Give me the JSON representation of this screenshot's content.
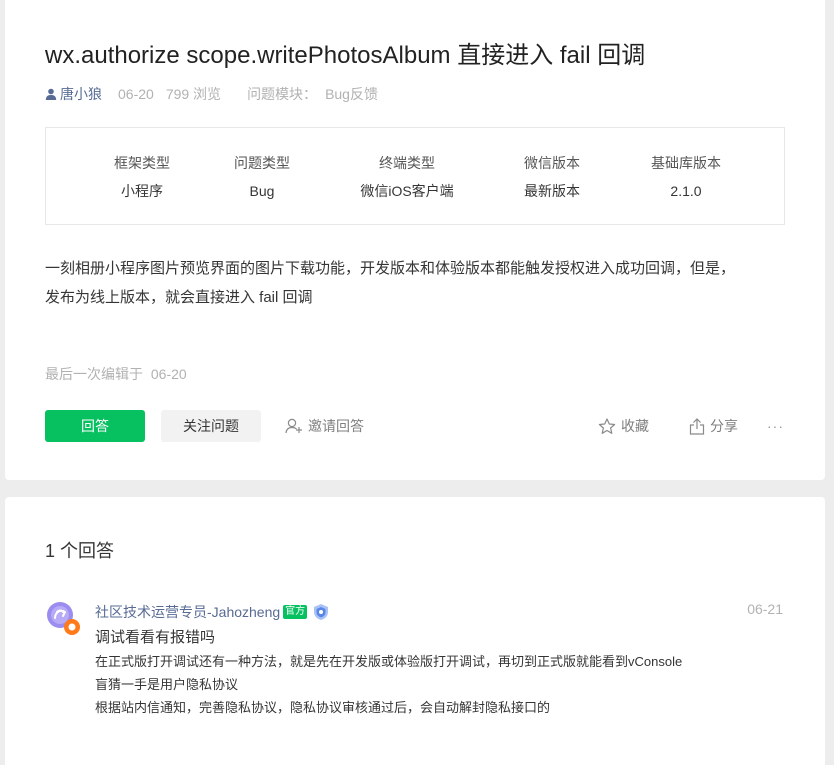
{
  "question": {
    "title": "wx.authorize scope.writePhotosAlbum 直接进入 fail 回调",
    "author": "唐小狼",
    "date": "06-20",
    "views": "799 浏览",
    "module_label": "问题模块：",
    "module_value": "Bug反馈",
    "info": [
      {
        "header": "框架类型",
        "value": "小程序"
      },
      {
        "header": "问题类型",
        "value": "Bug"
      },
      {
        "header": "终端类型",
        "value": "微信iOS客户端"
      },
      {
        "header": "微信版本",
        "value": "最新版本"
      },
      {
        "header": "基础库版本",
        "value": "2.1.0"
      }
    ],
    "body_line1": "一刻相册小程序图片预览界面的图片下载功能，开发版本和体验版本都能触发授权进入成功回调，但是，",
    "body_line2": "发布为线上版本，就会直接进入 fail 回调",
    "edited_label": "最后一次编辑于",
    "edited_date": "06-20"
  },
  "actions": {
    "answer": "回答",
    "follow": "关注问题",
    "invite": "邀请回答",
    "favorite": "收藏",
    "share": "分享",
    "more": "···"
  },
  "answers": {
    "count_label": "1 个回答",
    "items": [
      {
        "author": "社区技术运营专员-Jahozheng",
        "badge": "官方",
        "date": "06-21",
        "title": "调试看看有报错吗",
        "lines": [
          "在正式版打开调试还有一种方法，就是先在开发版或体验版打开调试，再切到正式版就能看到vConsole",
          "盲猜一手是用户隐私协议",
          "根据站内信通知，完善隐私协议，隐私协议审核通过后，会自动解封隐私接口的"
        ]
      }
    ]
  },
  "colors": {
    "accent_green": "#07c160",
    "link_blue": "#576b95",
    "muted": "#b2b2b2"
  },
  "icons": [
    "user-icon",
    "invite-icon",
    "star-icon",
    "share-icon",
    "more-icon",
    "avatar-icon",
    "shield-icon"
  ]
}
